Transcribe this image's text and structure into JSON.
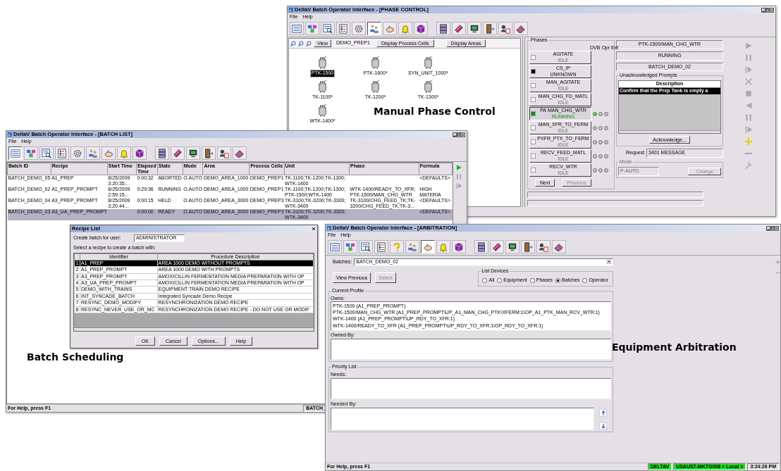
{
  "phase_window": {
    "title": "DeltaV Batch Operator Interface - [PHASE CONTROL]",
    "menu": [
      "File",
      "Help"
    ],
    "toolbar": [
      [
        {
          "kind": "list",
          "selected": false
        },
        {
          "kind": "network",
          "selected": false
        },
        {
          "kind": "search-list",
          "selected": false
        },
        {
          "kind": "grid",
          "selected": false
        },
        {
          "kind": "gear",
          "selected": false
        },
        {
          "kind": "people",
          "selected": true
        },
        {
          "kind": "hand",
          "selected": false
        },
        {
          "kind": "bell",
          "selected": false
        },
        {
          "kind": "cube",
          "selected": false
        }
      ],
      [
        {
          "kind": "server",
          "selected": false
        },
        {
          "kind": "book",
          "selected": false
        },
        {
          "kind": "monitor",
          "selected": false
        },
        {
          "kind": "door",
          "selected": false
        },
        {
          "kind": "users",
          "selected": false
        },
        {
          "kind": "eraser",
          "selected": false
        }
      ]
    ],
    "view_button": "View",
    "cell": "DEMO_PREP1",
    "display_buttons": [
      "Display Process Cells",
      "Display Areas"
    ],
    "units": [
      {
        "name": "PTK-1500",
        "selected": true
      },
      {
        "name": "PTK-1600*",
        "selected": false
      },
      {
        "name": "SYN_UNIT_1000*",
        "selected": false
      },
      {
        "name": "TK-1100*",
        "selected": false
      },
      {
        "name": "TK-1200*",
        "selected": false
      },
      {
        "name": "TK-1300*",
        "selected": false
      },
      {
        "name": "WTK-1400*",
        "selected": false
      }
    ],
    "phases_label": "Phases",
    "light_headers": [
      "DVB",
      "Opr",
      "Ext"
    ],
    "phases": [
      {
        "name": "AGITATE",
        "state": "IDLE",
        "color": "#ffffff",
        "selected": false
      },
      {
        "name": "CS_IP",
        "state": "UNKNOWN",
        "color": "#000000",
        "selected": false
      },
      {
        "name": "MAN_AGITATE",
        "state": "IDLE",
        "color": "#ffffff",
        "selected": false
      },
      {
        "name": "MAN_CHG_FD_MATL",
        "state": "IDLE",
        "color": "#ffffff",
        "selected": false
      },
      {
        "name": "MAN_CHG_WTR",
        "tag": "PA",
        "state": "RUNNING",
        "color": "#138a13",
        "selected": true,
        "lights": [
          {
            "on": true
          },
          {
            "on": false
          },
          {
            "on": false
          }
        ]
      },
      {
        "name": "MAN_XFR_TO_FERM",
        "state": "IDLE",
        "color": "#ffffff",
        "selected": false,
        "lights": [
          {
            "on": false
          },
          {
            "on": false
          },
          {
            "on": false
          }
        ]
      },
      {
        "name": "PXFR_PTX_TO_FERM",
        "state": "IDLE",
        "color": "#ffffff",
        "selected": false,
        "lights": [
          {
            "on": false
          },
          {
            "on": false
          },
          {
            "on": false
          }
        ]
      },
      {
        "name": "RECV_FEED_MATL",
        "state": "IDLE",
        "color": "#ffffff",
        "selected": false,
        "lights": [
          {
            "on": false
          },
          {
            "on": false
          },
          {
            "on": false
          }
        ]
      },
      {
        "name": "RECV_WTR",
        "state": "IDLE",
        "color": "#ffffff",
        "selected": false,
        "lights": [
          {
            "on": false
          },
          {
            "on": false
          },
          {
            "on": false
          }
        ]
      }
    ],
    "nav_buttons": [
      {
        "label": "Next",
        "disabled": false
      },
      {
        "label": "Previous",
        "disabled": true
      }
    ],
    "info_fields": [
      "PTK-1500/MAN_CHG_WTR",
      "RUNNING",
      "BATCH_DEMO_02"
    ],
    "prompts": {
      "label": "Unacknowledged Prompts",
      "column": "Description",
      "rows": [
        {
          "text": "Confirm that the Prep Tank is empty a",
          "selected": true
        }
      ],
      "button": "Acknowledge..."
    },
    "request": {
      "label": "Request",
      "value": "3401 MESSAGE"
    },
    "mode": {
      "label": "Mode",
      "value": "P-AUTO",
      "button": "Change",
      "disabled": true
    },
    "commands": [
      {
        "kind": "play",
        "disabled": true
      },
      {
        "kind": "pause",
        "disabled": true
      },
      {
        "kind": "step",
        "disabled": true
      },
      {
        "kind": "cross",
        "disabled": true
      },
      {
        "kind": "stop",
        "disabled": true
      },
      {
        "kind": "back",
        "disabled": true
      },
      {
        "kind": "pause",
        "disabled": true
      },
      {
        "kind": "step",
        "disabled": true
      },
      {
        "kind": "plus",
        "disabled": false
      },
      {
        "kind": "minus",
        "disabled": true
      },
      {
        "kind": "wrench",
        "disabled": true
      }
    ]
  },
  "batch_window": {
    "title": "DeltaV Batch Operator Interface - [BATCH LIST]",
    "menu": [
      "File",
      "Help"
    ],
    "toolbar": [
      [
        {
          "kind": "list",
          "selected": true
        },
        {
          "kind": "network",
          "selected": false
        },
        {
          "kind": "search-list",
          "selected": false
        },
        {
          "kind": "grid",
          "selected": false
        },
        {
          "kind": "gear",
          "selected": false
        },
        {
          "kind": "people",
          "selected": false
        },
        {
          "kind": "hand",
          "selected": false
        },
        {
          "kind": "bell",
          "selected": false
        },
        {
          "kind": "cube",
          "selected": false
        }
      ],
      [
        {
          "kind": "server",
          "selected": false
        },
        {
          "kind": "book",
          "selected": false
        },
        {
          "kind": "monitor",
          "selected": false
        },
        {
          "kind": "door",
          "selected": false
        },
        {
          "kind": "users",
          "selected": false
        },
        {
          "kind": "eraser",
          "selected": false
        }
      ]
    ],
    "columns": [
      "Batch ID",
      "Recipe",
      "Start Time",
      "Elapsed Time",
      "State",
      "Mode",
      "Area",
      "Process Cells",
      "Unit",
      "Phase",
      "Formula"
    ],
    "rows": [
      {
        "selected": false,
        "cells": [
          "BATCH_DEMO_05",
          "A1_PREP",
          "8/25/2009 3:20:35...",
          "0:00:32",
          "ABORTED",
          "O.AUTO",
          "DEMO_AREA_1000",
          "DEMO_PREP1",
          "TK-1100;TK-1200;TK-1300;WTK-1400",
          "",
          "<DEFAULTS>"
        ]
      },
      {
        "selected": false,
        "cells": [
          "BATCH_DEMO_02",
          "A1_PREP_PROMPT",
          "8/25/2009 2:59:15...",
          "0:29:36",
          "RUNNING",
          "O.AUTO",
          "DEMO_AREA_1000",
          "DEMO_PREP1",
          "TK-1100;TK-1200;TK-1300;PTK-1500;WTK-1400",
          "WTK-1400/READY_TO_XFR;PTK-1500/MAN_CHG_WTR",
          "HIGH MATERIA"
        ]
      },
      {
        "selected": false,
        "cells": [
          "BATCH_DEMO_04",
          "A3_PREP_PROMPT",
          "8/25/2009 3:20:44...",
          "0:00:15",
          "HELD",
          "O.AUTO",
          "DEMO_AREA_3000",
          "DEMO_PREP3",
          "TK-3100;TK-3200;TK-3300;WTK-3400",
          "TK-3100/CHG_FEED_TK;TK-3200/CHG_FEED_TK;TK-3...",
          "<DEFAULTS>"
        ]
      },
      {
        "selected": true,
        "cells": [
          "BATCH_DEMO_03",
          "A3_UA_PREP_PROMPT",
          "",
          "0:00:00",
          "READY",
          "O.AUTO",
          "DEMO_AREA_3000",
          "DEMO_PREP3",
          "TK-3100;TK-3200;TK-3300;WTK-3400",
          "",
          "<DEFAULTS>"
        ]
      }
    ],
    "commands": [
      {
        "kind": "play",
        "disabled": false
      },
      {
        "kind": "pause",
        "disabled": true
      },
      {
        "kind": "step",
        "disabled": true
      }
    ],
    "status": [
      "For Help, press F1",
      "BATCH_"
    ],
    "recipe_dialog": {
      "title": "Recipe List",
      "user_label": "Create batch for user:",
      "user": "ADMINISTRATOR",
      "prompt": "Select a recipe to create a batch with:",
      "columns": [
        "Identifier",
        "Procedure Description"
      ],
      "rows": [
        {
          "number": "1",
          "identifier": "A1_PREP",
          "description": "AREA 1000 DEMO WITHOUT PROMPTS",
          "selected": true
        },
        {
          "number": "2",
          "identifier": "A1_PREP_PROMPT",
          "description": "AREA 1000 DEMO WITH PROMPTS",
          "selected": false
        },
        {
          "number": "3",
          "identifier": "A3_PREP_PROMPT",
          "description": "AMOXICILLIN FERMENTATION MEDIA PREPARATION WITH OP",
          "selected": false
        },
        {
          "number": "4",
          "identifier": "A3_UA_PREP_PROMPT",
          "description": "AMOXICILLIN FERMENTATION MEDIA PREPARATION WITH OP",
          "selected": false
        },
        {
          "number": "5",
          "identifier": "DEMO_WITH_TRAINS",
          "description": "EQUIPMENT TRAIN DEMO RECIPE",
          "selected": false
        },
        {
          "number": "6",
          "identifier": "INT_SYNCADE_BATCH",
          "description": "Integrated Syncade Demo Recipe",
          "selected": false
        },
        {
          "number": "7",
          "identifier": "RESYNC_DEMO_MODIFY",
          "description": "RESYNCHRONIZATION DEMO RECIPE",
          "selected": false
        },
        {
          "number": "8",
          "identifier": "RESYNC_NEVER_USE_OR_MC",
          "description": "RESYNCHRONIZATION DEMO RECIPE - DO NOT USE OR MODIF",
          "selected": false
        }
      ],
      "buttons": [
        "OK",
        "Cancel",
        "Options...",
        "Help"
      ]
    }
  },
  "arbitration_window": {
    "title": "DeltaV Batch Operator Interface - [ARBITRATION]",
    "menu": [
      "File",
      "Help"
    ],
    "toolbar": [
      [
        {
          "kind": "list",
          "selected": false
        },
        {
          "kind": "network",
          "selected": false
        },
        {
          "kind": "search-list",
          "selected": false
        },
        {
          "kind": "grid",
          "selected": false
        },
        {
          "kind": "help",
          "selected": false
        },
        {
          "kind": "people",
          "selected": false
        },
        {
          "kind": "hand",
          "selected": true
        },
        {
          "kind": "bell",
          "selected": false
        },
        {
          "kind": "cube",
          "selected": false
        }
      ],
      [
        {
          "kind": "server",
          "selected": false
        },
        {
          "kind": "book",
          "selected": false
        },
        {
          "kind": "monitor",
          "selected": false
        },
        {
          "kind": "door",
          "selected": false
        },
        {
          "kind": "users",
          "selected": false
        },
        {
          "kind": "eraser",
          "selected": false
        }
      ]
    ],
    "batches": {
      "label": "Batches:",
      "value": "BATCH_DEMO_02"
    },
    "buttons": [
      {
        "label": "View Previous",
        "disabled": false
      },
      {
        "label": "Select",
        "disabled": true
      }
    ],
    "list_devices": {
      "label": "List Devices",
      "options": [
        {
          "label": "All",
          "selected": false
        },
        {
          "label": "Equipment",
          "selected": false
        },
        {
          "label": "Phases",
          "selected": false
        },
        {
          "label": "Batches",
          "selected": true
        },
        {
          "label": "Operator",
          "selected": false
        }
      ]
    },
    "current_profile": {
      "label": "Current Profile",
      "owns_label": "Owns:",
      "owns": [
        "PTK-1500 (A1_PREP_PROMPT)",
        "PTK-1500/MAN_CHG_WTR (A1_PREP_PROMPT\\UP_A1_MAN_CHG_PTK\\XFERM:1\\OP_A1_PTK_MAN_RCV_WTR:1)",
        "WTK-1400 (A1_PREP_PROMPT\\UP_RDY_TO_XFR:1)",
        "WTK-1400/READY_TO_XFR (A1_PREP_PROMPT\\UP_RDY_TO_XFR:1\\OP_RDY_TO_XFR:1)"
      ],
      "owned_by_label": "Owned By:"
    },
    "priority": {
      "label": "Priority List",
      "needs_label": "Needs:",
      "needed_by_label": "Needed By:"
    },
    "side_commands": [
      {
        "kind": "plus",
        "disabled": true
      },
      {
        "kind": "minus",
        "disabled": true
      }
    ],
    "status": {
      "help": "For Help, press F1",
      "panes": [
        {
          "text": "DELTAV",
          "color": "#22e022"
        },
        {
          "text": "USAUST-MKTG008 < Local >",
          "color": "#22e022"
        },
        {
          "text": "3:24:26 PM",
          "color": "#e4e0e6"
        }
      ]
    }
  },
  "captions": [
    "Manual Phase Control",
    "Batch Scheduling",
    "Equipment Arbitration"
  ]
}
